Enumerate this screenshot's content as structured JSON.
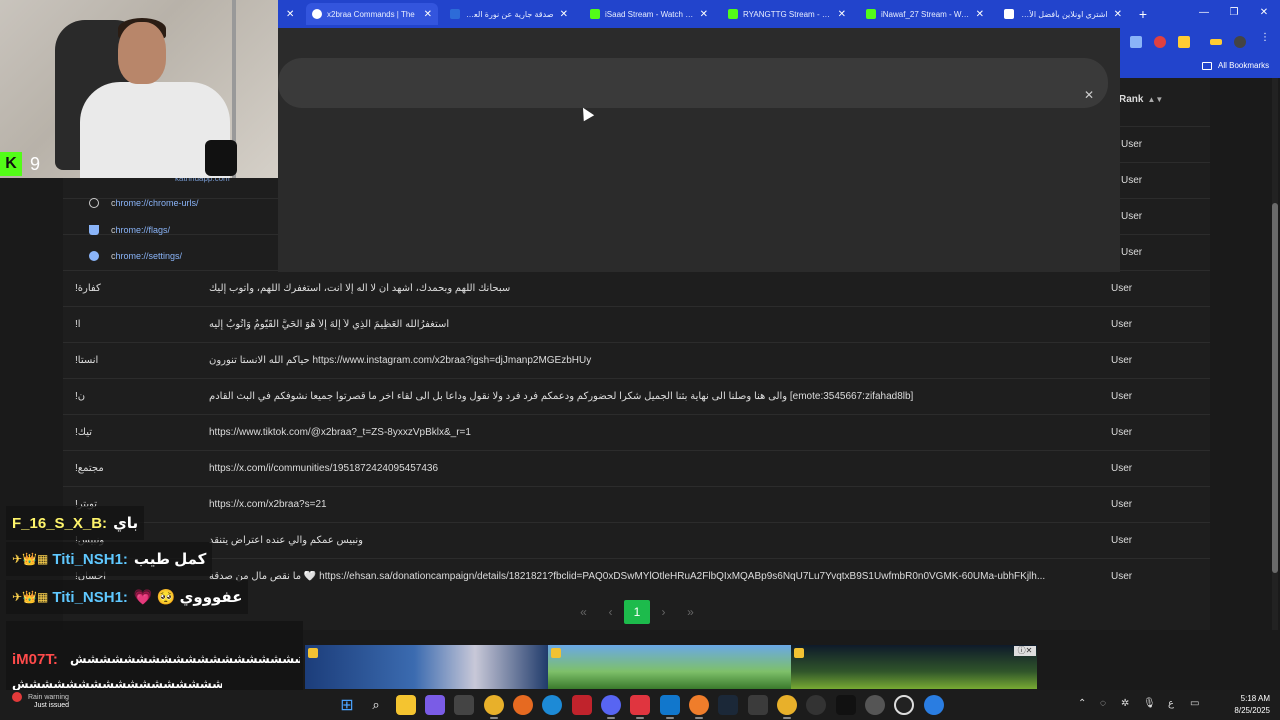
{
  "browser": {
    "tabs": [
      {
        "title": "x2braa Commands | The",
        "active": true,
        "favicon_color": "#ffffff"
      },
      {
        "title": "صدقة جارية عن نورة العتي",
        "active": false,
        "favicon_color": "#2d6bd8"
      },
      {
        "title": "iSaad Stream - Watch Live",
        "active": false,
        "favicon_color": "#53fc18"
      },
      {
        "title": "RYANGTTG Stream - Watc",
        "active": false,
        "favicon_color": "#53fc18"
      },
      {
        "title": "iNawaf_27 Stream - Watc",
        "active": false,
        "favicon_color": "#53fc18"
      },
      {
        "title": "اشتري اونلاين بأفضل الأسع",
        "active": false,
        "favicon_color": "#ffffff"
      }
    ],
    "bookmarks_label": "All Bookmarks"
  },
  "omnibox": {
    "suggestions": [
      {
        "prefix": "c",
        "text": "hrome://chrome-urls/",
        "icon": "globe-icon"
      },
      {
        "prefix": "c",
        "text": "hrome://flags/",
        "icon": "flask-icon"
      },
      {
        "prefix": "c",
        "text": "hrome://settings/",
        "icon": "gear-icon"
      }
    ],
    "partial_text": "kathhdapp.com"
  },
  "table": {
    "rank_header": "Rank",
    "ghost_rows": [
      "User",
      "User",
      "User",
      "User"
    ],
    "rows": [
      {
        "command": "!كفارة",
        "response": "سبحانك اللهم وبحمدك، أشهد أن لا أله إلا أنت، أستغفرك اللهم، وأتوب إليك",
        "rank": "User"
      },
      {
        "command": "!ا",
        "response": "أستغفرُاللّٰه العَظِيمَ الذِي لاَ إِلَهَ إِلاَّ هُوَ الحَيُّ القَيُّومُ وَأَتُوبُ إِلَيه",
        "rank": "User"
      },
      {
        "command": "!انستا",
        "response": "حياكم الله الانستا تنورون https://www.instagram.com/x2braa?igsh=djJmanp2MGEzbHUy",
        "rank": "User"
      },
      {
        "command": "!ن",
        "response": "والى هنا وصلنا الى نهاية بثنا الجميل شكرا لحضوركم ودعمكم فرد فرد ولا نقول وداعاً بل الى لقاء اخر ما قصرتوا جميعا نشوفكم في البث القادم [emote:3545667:zifahad8lb]",
        "rank": "User"
      },
      {
        "command": "!تيك",
        "response": "https://www.tiktok.com/@x2braa?_t=ZS-8yxxzVpBklx&_r=1",
        "rank": "User"
      },
      {
        "command": "!مجتمع",
        "response": "https://x.com/i/communities/1951872424095457436",
        "rank": "User"
      },
      {
        "command": "!تويتر",
        "response": "https://x.com/x2braa?s=21",
        "rank": "User"
      },
      {
        "command": "!ونبيس",
        "response": "ونبيس عمكم والي عنده اعتراض يتنقد",
        "rank": "User"
      },
      {
        "command": "!احسان",
        "response": "ما نقص مال من صدقة 🤍 https://ehsan.sa/donationcampaign/details/1821821?fbclid=PAQ0xDSwMYlOtleHRuA2FlbQIxMQABp9s6NqU7Lu7YvqtxB9S1UwfmbR0n0VGMK-60UMa-ubhFKjlh...",
        "rank": "User"
      }
    ]
  },
  "pagination": {
    "first": "«",
    "prev": "‹",
    "current": "1",
    "next": "›",
    "last": "»"
  },
  "stream": {
    "viewer_count": "9",
    "kick_logo": "K"
  },
  "chat": [
    {
      "user": "F_16_S_X_B:",
      "text": "باي",
      "badges": "",
      "style": "yellow"
    },
    {
      "user": "Titi_NSH1:",
      "text": "كمل طيب",
      "badges": "✈👑▦",
      "style": "blue"
    },
    {
      "user": "Titi_NSH1:",
      "text": "💗 🥺 عفوووي",
      "badges": "✈👑▦",
      "style": "blue"
    }
  ],
  "chat_last": {
    "user": "iM07T:",
    "text1": "ششششششششششششششششششششششششششش",
    "text2": "ششششششششششششششششششششششششش"
  },
  "taskbar": {
    "weather_title": "Rain warning",
    "weather_sub": "Just issued",
    "time": "5:18 AM",
    "date": "8/25/2025",
    "lang": "ع"
  }
}
